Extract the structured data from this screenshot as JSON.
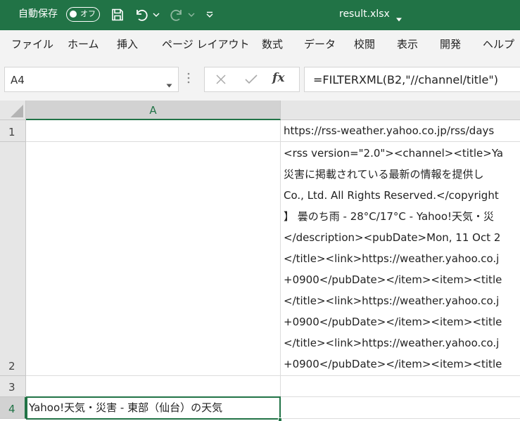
{
  "titlebar": {
    "autosave_label": "自動保存",
    "autosave_state": "オフ",
    "file_name": "result.xlsx",
    "accent_color": "#217346"
  },
  "ribbon": {
    "tabs": [
      "ファイル",
      "ホーム",
      "挿入",
      "ページ レイアウト",
      "数式",
      "データ",
      "校閲",
      "表示",
      "開発",
      "ヘルプ"
    ]
  },
  "formula_bar": {
    "name_box": "A4",
    "fx_label": "fx",
    "formula": "=FILTERXML(B2,\"//channel/title\")"
  },
  "grid": {
    "columns": [
      "A"
    ],
    "rows": [
      "1",
      "2",
      "3",
      "4"
    ],
    "b1": "https://rss-weather.yahoo.co.jp/rss/days",
    "b2_lines": [
      "<rss version=\"2.0\"><channel><title>Ya",
      "災害に掲載されている最新の情報を提供し",
      "Co., Ltd. All Rights Reserved.</copyright",
      "】 曇のち雨 - 28°C/17°C - Yahoo!天気・災",
      "</description><pubDate>Mon, 11 Oct 2",
      "</title><link>https://weather.yahoo.co.j",
      "+0900</pubDate></item><item><title",
      "</title><link>https://weather.yahoo.co.j",
      "+0900</pubDate></item><item><title",
      "</title><link>https://weather.yahoo.co.j",
      "+0900</pubDate></item><item><title"
    ],
    "a4": "Yahoo!天気・災害 - 東部（仙台）の天気"
  }
}
